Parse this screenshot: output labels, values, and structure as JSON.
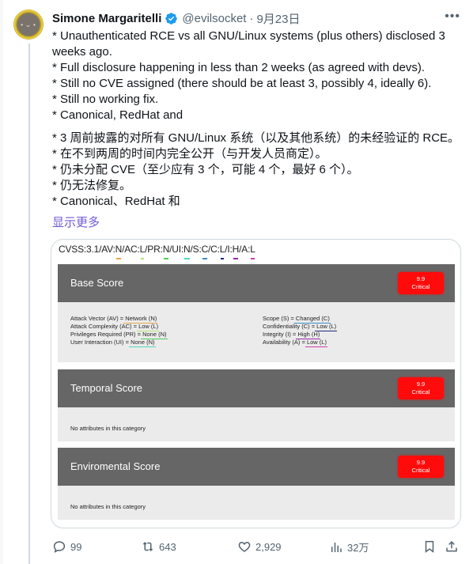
{
  "tweet": {
    "author": {
      "display_name": "Simone Margaritelli",
      "verified": true,
      "handle": "@evilsocket",
      "avatar_icon": "avatar-image"
    },
    "separator": "·",
    "date": "9月23日",
    "more_icon": "more-icon",
    "text_en": [
      "* Unauthenticated RCE vs all GNU/Linux systems (plus others) disclosed 3",
      "weeks ago.",
      "* Full disclosure happening in less than 2 weeks (as agreed with devs).",
      "* Still no CVE assigned (there should be at least 3, possibly 4, ideally 6).",
      "* Still no working fix.",
      "* Canonical, RedHat and"
    ],
    "text_zh": [
      "* 3 周前披露的对所有 GNU/Linux 系统（以及其他系统）的未经验证的 RCE。",
      "* 在不到两周的时间内完全公开（与开发人员商定）。",
      "* 仍未分配 CVE（至少应有 3 个，可能 4 个，最好 6 个）。",
      "* 仍无法修复。",
      "* Canonical、RedHat 和"
    ],
    "show_more": "显示更多"
  },
  "cvss_card": {
    "vector": [
      {
        "text": "CVSS:3.1/AV:",
        "highlight": ""
      },
      {
        "text": "N",
        "highlight": "#e8a64a"
      },
      {
        "text": "/AC:",
        "highlight": ""
      },
      {
        "text": "L",
        "highlight": "#b5e67a"
      },
      {
        "text": "/PR:",
        "highlight": ""
      },
      {
        "text": "N",
        "highlight": "#4ccf5a"
      },
      {
        "text": "/UI:",
        "highlight": ""
      },
      {
        "text": "N",
        "highlight": "#4dd6c0"
      },
      {
        "text": "/S:",
        "highlight": ""
      },
      {
        "text": "C",
        "highlight": "#3a8fc8"
      },
      {
        "text": "/C:",
        "highlight": ""
      },
      {
        "text": "L",
        "highlight": "#1c2a80"
      },
      {
        "text": "/I:",
        "highlight": ""
      },
      {
        "text": "H",
        "highlight": "#9b27b0"
      },
      {
        "text": "/A:",
        "highlight": ""
      },
      {
        "text": "L",
        "highlight": "#d63aa8"
      }
    ],
    "sections": [
      {
        "title": "Base Score",
        "score": "9.9",
        "severity": "Critical",
        "severity_color": "#ff0b0b",
        "metrics_left": [
          {
            "label": "Attack Vector (AV) = ",
            "value": "Network (N)",
            "color": "#e8a64a"
          },
          {
            "label": "Attack Complexity (AC) = ",
            "value": "Low (L)",
            "color": "#b5e67a"
          },
          {
            "label": "Privileges Required (PR) = ",
            "value": "None (N)",
            "color": "#4ccf5a"
          },
          {
            "label": "User Interaction (UI) = ",
            "value": "None (N)",
            "color": "#4dd6c0"
          }
        ],
        "metrics_right": [
          {
            "label": "Scope (S) = ",
            "value": "Changed (C)",
            "color": "#3a8fc8"
          },
          {
            "label": "Confidentiality (C) = ",
            "value": "Low (L)",
            "color": "#1c2a80"
          },
          {
            "label": "Integrity (I) = ",
            "value": "High (H)",
            "color": "#9b27b0"
          },
          {
            "label": "Availability (A) = ",
            "value": "Low (L)",
            "color": "#d63aa8"
          }
        ]
      },
      {
        "title": "Temporal Score",
        "score": "9.9",
        "severity": "Critical",
        "note": "No attributes in this category"
      },
      {
        "title": "Enviromental Score",
        "score": "9.9",
        "severity": "Critical",
        "note": "No attributes in this category"
      }
    ]
  },
  "actions": {
    "replies": "99",
    "retweets": "643",
    "likes": "2,929",
    "views": "32万"
  }
}
